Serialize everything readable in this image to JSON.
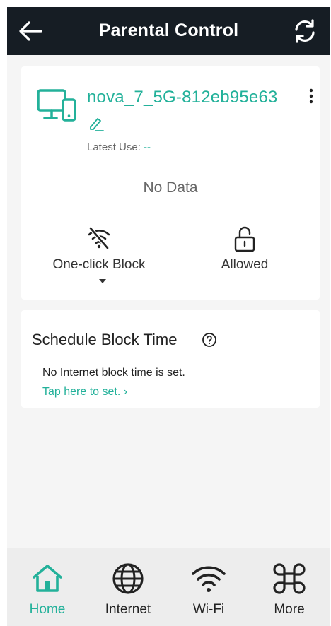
{
  "header": {
    "title": "Parental Control"
  },
  "device": {
    "name": "nova_7_5G-812eb95e63",
    "latest_use_label": "Latest Use:",
    "latest_use_value": "--",
    "no_data": "No Data"
  },
  "actions": {
    "block_label": "One-click Block",
    "allowed_label": "Allowed"
  },
  "schedule": {
    "title": "Schedule Block Time",
    "message": "No Internet block time is set.",
    "link": "Tap here to set. ›"
  },
  "tabs": [
    {
      "label": "Home",
      "icon": "home-icon",
      "active": true
    },
    {
      "label": "Internet",
      "icon": "globe-icon",
      "active": false
    },
    {
      "label": "Wi-Fi",
      "icon": "wifi-icon",
      "active": false
    },
    {
      "label": "More",
      "icon": "command-icon",
      "active": false
    }
  ],
  "colors": {
    "accent": "#23b19a",
    "header_bg": "#161d24",
    "page_bg": "#f5f5f5"
  }
}
